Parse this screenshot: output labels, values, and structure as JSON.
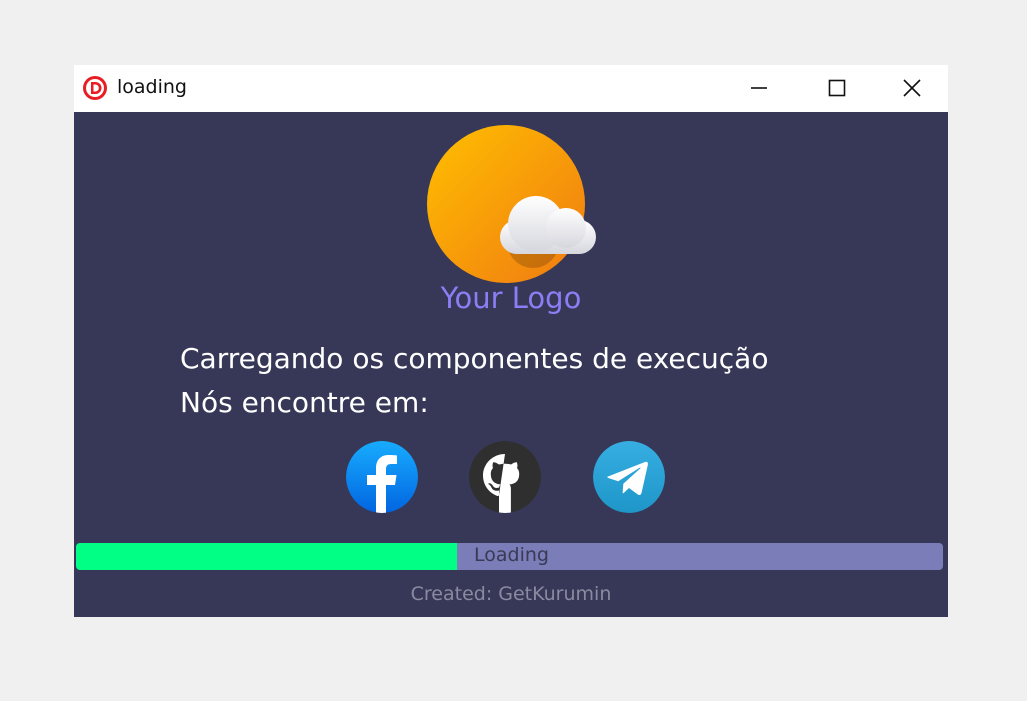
{
  "window": {
    "title": "loading",
    "app_icon": "d-logo-icon",
    "controls": [
      "minimize-icon",
      "maximize-icon",
      "close-icon"
    ]
  },
  "logo": {
    "text": "Your Logo",
    "icon": "sun-cloud-icon"
  },
  "messages": {
    "line1": "Carregando os componentes de execução",
    "line2": "Nós encontre em:"
  },
  "social": [
    {
      "name": "facebook-icon",
      "color": "#1877f2"
    },
    {
      "name": "github-icon",
      "color": "#2f2f2f"
    },
    {
      "name": "telegram-icon",
      "color": "#2aa3e0"
    }
  ],
  "progress": {
    "label": "Loading",
    "value": 0.44,
    "fill_color": "#00ff84",
    "track_color": "#7a7db8"
  },
  "footer": {
    "credit": "Created: GetKurumin"
  },
  "colors": {
    "background": "#373857",
    "logo_text": "#8a7ef5"
  }
}
